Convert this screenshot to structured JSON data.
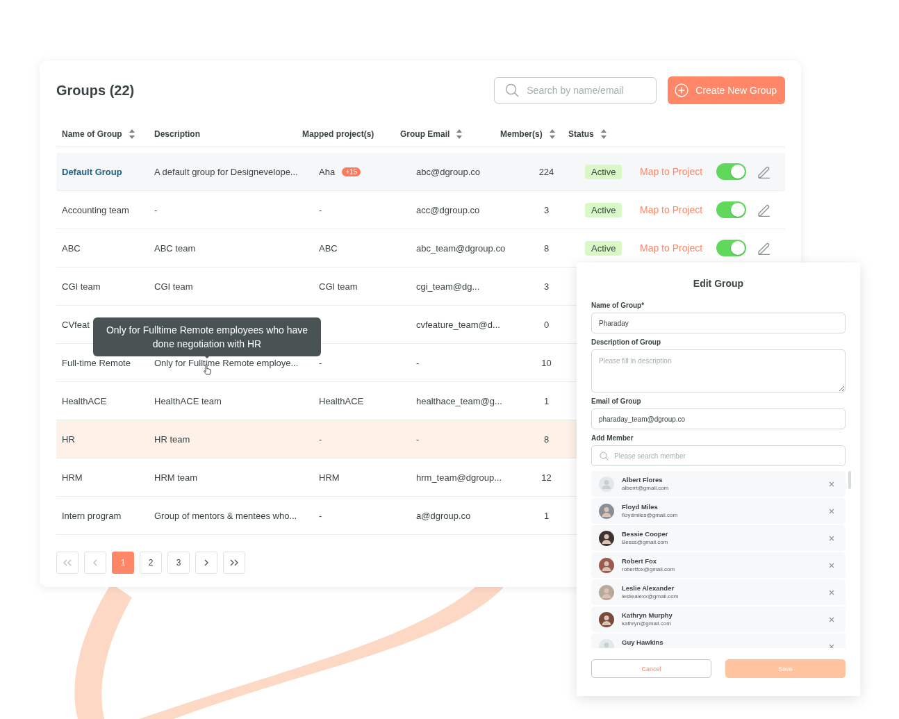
{
  "title": "Groups (22)",
  "search": {
    "placeholder": "Search by name/email"
  },
  "create_button": "Create New Group",
  "columns": [
    {
      "label": "Name of Group",
      "sortable": true
    },
    {
      "label": "Description",
      "sortable": false
    },
    {
      "label": "Mapped project(s)",
      "sortable": false
    },
    {
      "label": "Group Email",
      "sortable": true
    },
    {
      "label": "Member(s)",
      "sortable": true
    },
    {
      "label": "Status",
      "sortable": true
    }
  ],
  "rows": [
    {
      "name": "Default Group",
      "description": "A default group for Designevelope...",
      "project": "Aha",
      "project_badge": "+15",
      "email": "abc@dgroup.co",
      "members": "224",
      "status": "Active",
      "action": "Map to Project",
      "toggle_on": true,
      "selected": true,
      "hovered": false
    },
    {
      "name": "Accounting team",
      "description": "-",
      "project": "-",
      "email": "acc@dgroup.co",
      "members": "3",
      "status": "Active",
      "action": "Map to Project",
      "toggle_on": true,
      "selected": false,
      "hovered": false
    },
    {
      "name": "ABC",
      "description": "ABC team",
      "project": "ABC",
      "email": "abc_team@dgroup.co",
      "members": "8",
      "status": "Active",
      "action": "Map to Project",
      "toggle_on": true,
      "selected": false,
      "hovered": false
    },
    {
      "name": "CGI team",
      "description": "CGI team",
      "project": "CGI team",
      "email": "cgi_team@dg...",
      "members": "3",
      "selected": false,
      "hovered": false
    },
    {
      "name": "CVfeat",
      "email": "cvfeature_team@d...",
      "members": "0",
      "selected": false,
      "hovered": false
    },
    {
      "name": "Full-time Remote",
      "description": "Only for Fulltime Remote employe...",
      "project": "-",
      "email": "-",
      "members": "10",
      "selected": false,
      "hovered": false
    },
    {
      "name": "HealthACE",
      "description": "HealthACE team",
      "project": "HealthACE",
      "email": "healthace_team@g...",
      "members": "1",
      "selected": false,
      "hovered": false
    },
    {
      "name": "HR",
      "description": "HR team",
      "project": "-",
      "email": "-",
      "members": "8",
      "selected": false,
      "hovered": true
    },
    {
      "name": "HRM",
      "description": "HRM team",
      "project": "HRM",
      "email": "hrm_team@dgroup...",
      "members": "12",
      "selected": false,
      "hovered": false
    },
    {
      "name": "Intern program",
      "description": "Group of mentors & mentees who...",
      "project": "-",
      "email": "a@dgroup.co",
      "members": "1",
      "selected": false,
      "hovered": false
    }
  ],
  "tooltip": "Only for Fulltime Remote employees who have done negotiation with HR",
  "pages": [
    {
      "label": "1",
      "selected": true
    },
    {
      "label": "2",
      "selected": false
    },
    {
      "label": "3",
      "selected": false
    }
  ],
  "edit_panel": {
    "title": "Edit Group",
    "fields": [
      {
        "kind": "input",
        "label": "Name of Group*",
        "value": "Pharaday"
      },
      {
        "kind": "textarea",
        "label": "Description of Group",
        "placeholder": "Please fill in description"
      },
      {
        "kind": "input",
        "label": "Email of Group",
        "value": "pharaday_team@dgroup.co"
      },
      {
        "kind": "search",
        "label": "Add Member",
        "placeholder": "Please search member"
      }
    ],
    "members": [
      {
        "name": "Albert Flores",
        "email": "alberrt@gmail.com",
        "has_photo": false
      },
      {
        "name": "Floyd Miles",
        "email": "floydmiles@gmail.com",
        "has_photo": true
      },
      {
        "name": "Bessie Cooper",
        "email": "Besss@gmail.com",
        "has_photo": true
      },
      {
        "name": "Robert Fox",
        "email": "robertfox@gmail.com",
        "has_photo": true
      },
      {
        "name": "Leslie Alexander",
        "email": "lesliealexx@gmail.com",
        "has_photo": true
      },
      {
        "name": "Kathryn Murphy",
        "email": "kathryn@gmail.com",
        "has_photo": true
      },
      {
        "name": "Guy Hawkins",
        "has_photo": false
      }
    ],
    "cancel_button": "Cancel",
    "save_button": {
      "label": "Save",
      "disabled": true
    }
  }
}
